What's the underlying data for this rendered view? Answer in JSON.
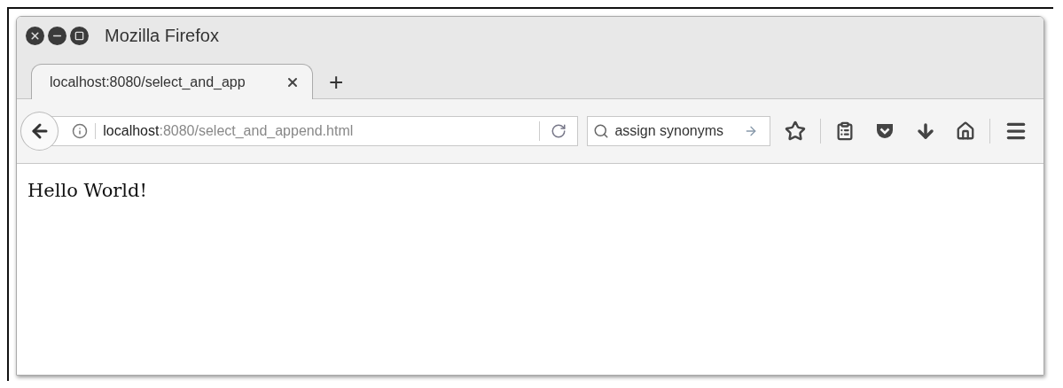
{
  "window": {
    "title": "Mozilla Firefox"
  },
  "tabs": [
    {
      "label": "localhost:8080/select_and_app",
      "selected": true
    }
  ],
  "new_tab": "+",
  "address_bar": {
    "host": "localhost",
    "path": ":8080/select_and_append.html"
  },
  "search": {
    "value": "assign synonyms"
  },
  "page": {
    "text": "Hello World!"
  }
}
